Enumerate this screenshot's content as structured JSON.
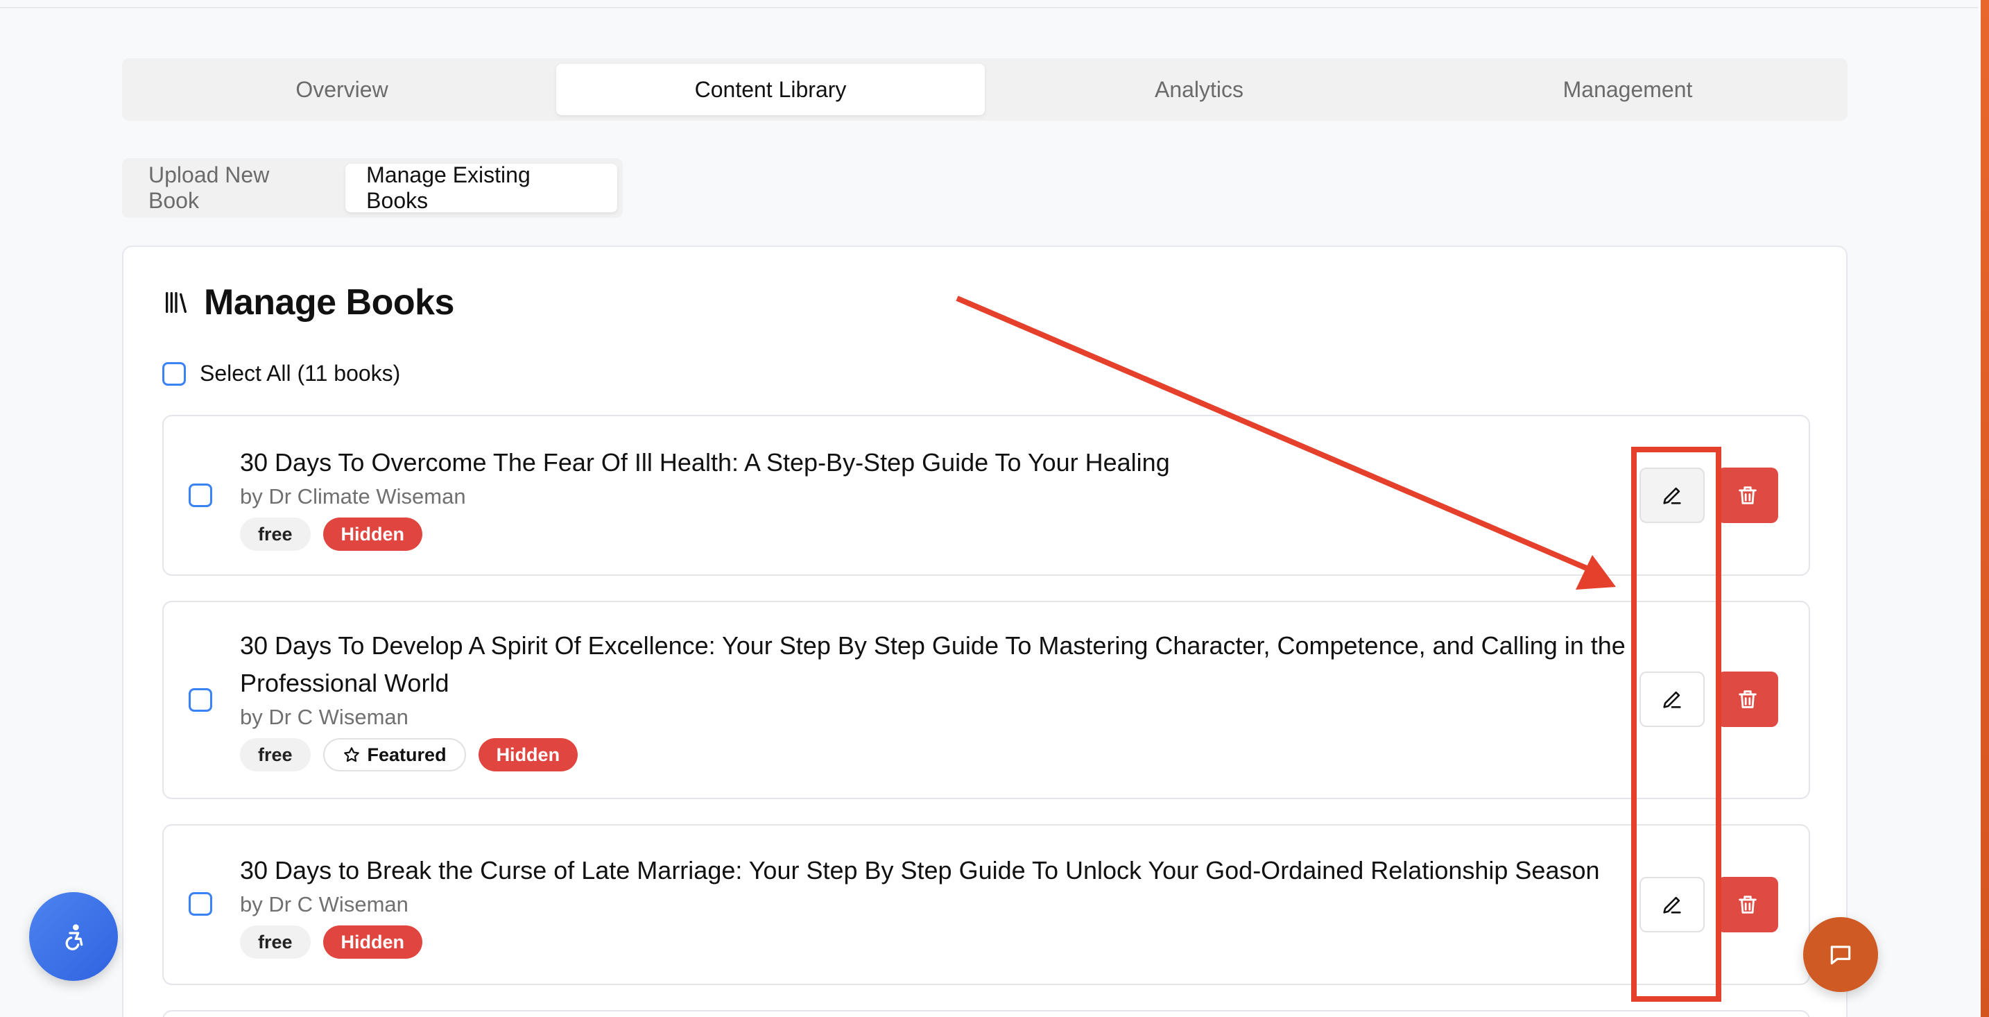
{
  "tabs": [
    {
      "label": "Overview"
    },
    {
      "label": "Content Library"
    },
    {
      "label": "Analytics"
    },
    {
      "label": "Management"
    }
  ],
  "subtabs": [
    {
      "label": "Upload New Book"
    },
    {
      "label": "Manage Existing Books"
    }
  ],
  "manage": {
    "title": "Manage Books",
    "select_all_label": "Select All (11 books)"
  },
  "books": [
    {
      "title": "30 Days To Overcome The Fear Of Ill Health: A Step-By-Step Guide To Your Healing",
      "author": "by Dr Climate Wiseman",
      "badges": {
        "free": "free",
        "featured": "",
        "hidden": "Hidden"
      }
    },
    {
      "title": "30 Days To Develop A Spirit Of Excellence: Your Step By Step Guide To Mastering Character, Competence, and Calling in the Professional World",
      "author": "by Dr C Wiseman",
      "badges": {
        "free": "free",
        "featured": "Featured",
        "hidden": "Hidden"
      }
    },
    {
      "title": "30 Days to Break the Curse of Late Marriage: Your Step By Step Guide To Unlock Your God-Ordained Relationship Season",
      "author": "by Dr C Wiseman",
      "badges": {
        "free": "free",
        "featured": "",
        "hidden": "Hidden"
      }
    }
  ],
  "colors": {
    "accent": "#3b82f6",
    "danger": "#df4a43",
    "annotation": "#e5402b",
    "chat": "#cf5a23"
  },
  "icons": {
    "library": "library-icon",
    "edit": "pencil-icon",
    "delete": "trash-icon",
    "featured": "star-icon",
    "accessibility": "accessibility-icon",
    "chat": "chat-icon"
  }
}
